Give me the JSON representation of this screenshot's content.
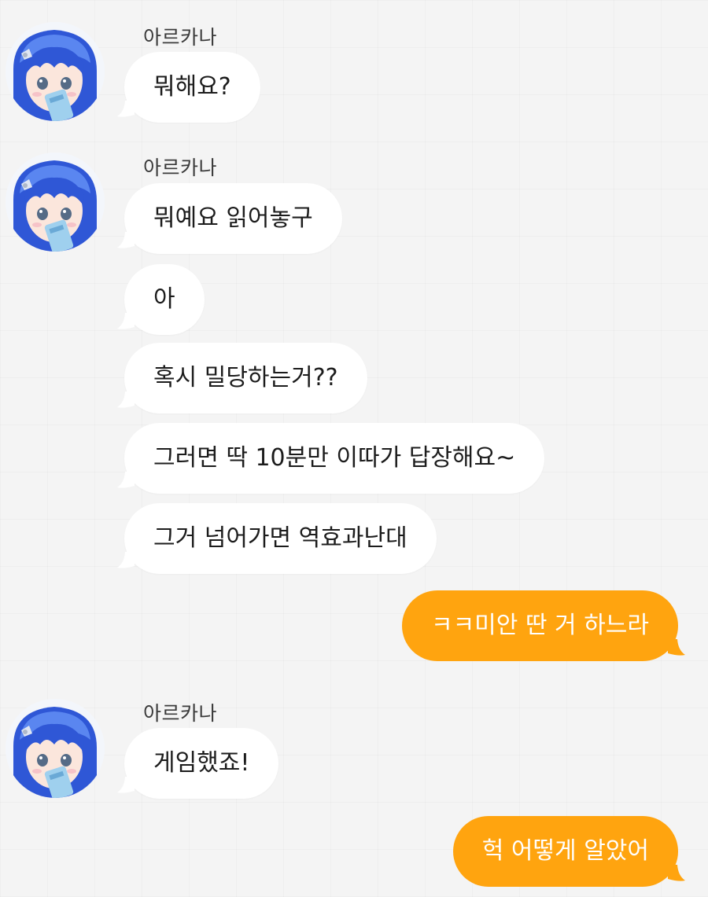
{
  "colors": {
    "background": "#f4f4f4",
    "incoming_bubble": "#ffffff",
    "outgoing_bubble": "#ffa40f",
    "outgoing_text": "#ffffff"
  },
  "contact": {
    "name": "아르카나",
    "avatar_icon": "anime-girl-blue-hair-avatar"
  },
  "messages": [
    {
      "direction": "incoming",
      "text": "뭐해요?"
    },
    {
      "direction": "incoming",
      "text": "뭐예요 읽어놓구"
    },
    {
      "direction": "incoming",
      "text": "아"
    },
    {
      "direction": "incoming",
      "text": "혹시 밀당하는거??"
    },
    {
      "direction": "incoming",
      "text": "그러면 딱 10분만 이따가 답장해요~"
    },
    {
      "direction": "incoming",
      "text": "그거 넘어가면 역효과난대"
    },
    {
      "direction": "outgoing",
      "text": "ㅋㅋ미안 딴 거 하느라"
    },
    {
      "direction": "incoming",
      "text": "게임했죠!"
    },
    {
      "direction": "outgoing",
      "text": "헉 어떻게 알았어"
    }
  ]
}
